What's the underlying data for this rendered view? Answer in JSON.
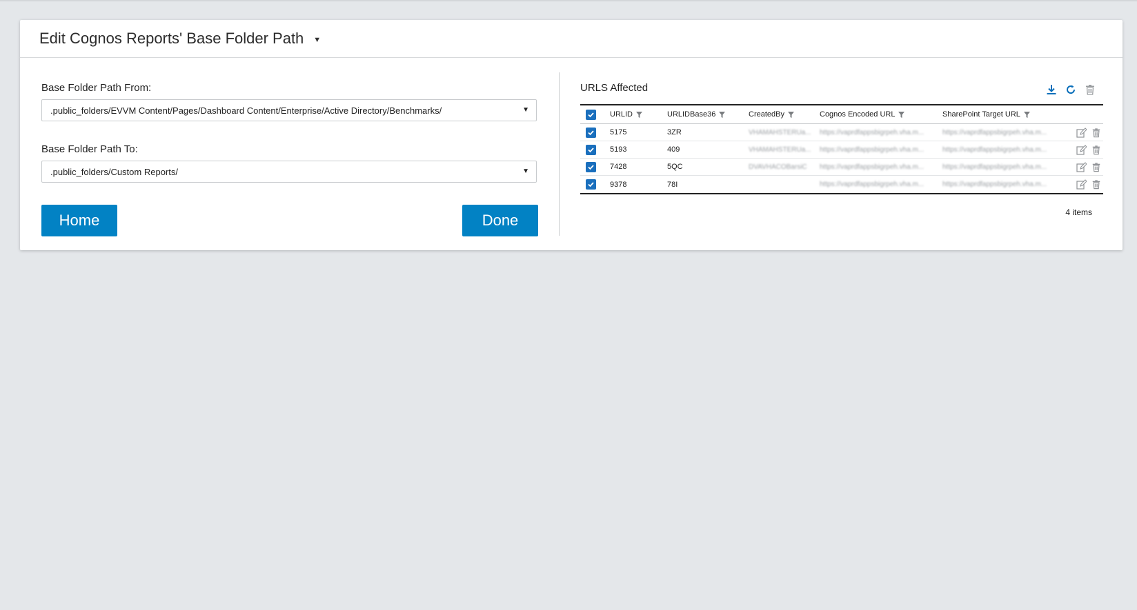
{
  "page": {
    "title": "Edit Cognos Reports' Base Folder Path"
  },
  "form": {
    "from_label": "Base Folder Path From:",
    "from_value": ".public_folders/EVVM Content/Pages/Dashboard Content/Enterprise/Active Directory/Benchmarks/",
    "to_label": "Base Folder Path To:",
    "to_value": ".public_folders/Custom Reports/",
    "home_label": "Home",
    "done_label": "Done"
  },
  "urls": {
    "title": "URLS Affected",
    "columns": [
      "URLID",
      "URLIDBase36",
      "CreatedBy",
      "Cognos Encoded URL",
      "SharePoint Target URL"
    ],
    "rows": [
      {
        "id": "5175",
        "b36": "3ZR",
        "created_by": "VHAMAHSTERUa...",
        "cognos": "https://vaprdfappsbigrpeh.vha.m...",
        "sharepoint": "https://vaprdfappsbigrpeh.vha.m..."
      },
      {
        "id": "5193",
        "b36": "409",
        "created_by": "VHAMAHSTERUa...",
        "cognos": "https://vaprdfappsbigrpeh.vha.m...",
        "sharepoint": "https://vaprdfappsbigrpeh.vha.m..."
      },
      {
        "id": "7428",
        "b36": "5QC",
        "created_by": "DVAVHACOBarsiC",
        "cognos": "https://vaprdfappsbigrpeh.vha.m...",
        "sharepoint": "https://vaprdfappsbigrpeh.vha.m..."
      },
      {
        "id": "9378",
        "b36": "78I",
        "created_by": "",
        "cognos": "https://vaprdfappsbigrpeh.vha.m...",
        "sharepoint": "https://vaprdfappsbigrpeh.vha.m..."
      }
    ],
    "count": "4 items"
  },
  "colors": {
    "accent": "#0282c4",
    "checkbox": "#1a6fbd",
    "background": "#e4e7ea"
  },
  "icons": [
    "caret-down-icon",
    "download-icon",
    "refresh-icon",
    "trash-icon",
    "filter-icon",
    "edit-icon",
    "check-icon"
  ]
}
